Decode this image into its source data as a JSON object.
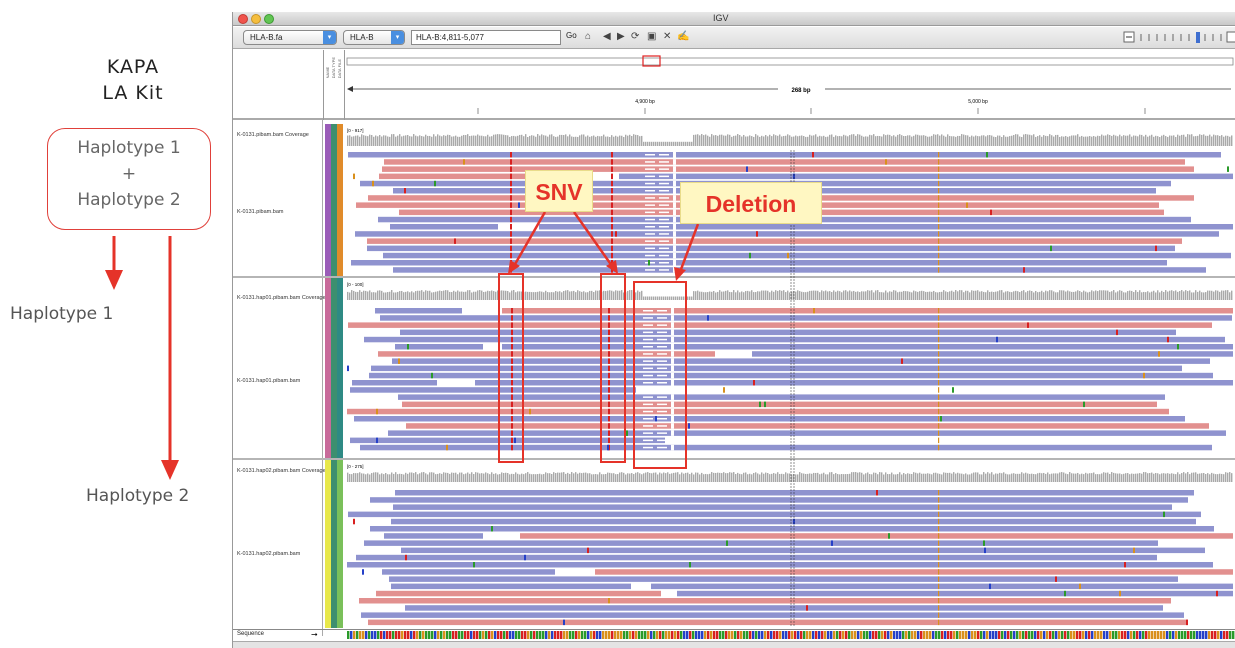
{
  "annotations": {
    "kit_line1": "KAPA",
    "kit_line2": "LA Kit",
    "combined_line1": "Haplotype 1",
    "combined_plus": "+",
    "combined_line2": "Haplotype 2",
    "haplotype1_label": "Haplotype 1",
    "haplotype2_label": "Haplotype 2",
    "snv_callout": "SNV",
    "deletion_callout": "Deletion",
    "accent_color": "#e53329",
    "callout_bg": "#fff7c2"
  },
  "window": {
    "title": "IGV"
  },
  "toolbar": {
    "genome": "HLA-B.fa",
    "chromosome": "HLA-B",
    "locus": "HLA-B:4,811-5,077",
    "go_label": "Go",
    "icons": [
      "home-icon",
      "back-icon",
      "forward-icon",
      "refresh-icon",
      "roi-icon",
      "close-icon",
      "popup-text-icon"
    ]
  },
  "ruler": {
    "span_label": "268 bp",
    "tick1": "4,900 bp",
    "tick2": "5,000 bp"
  },
  "attributes": {
    "headers": [
      "NAME",
      "DATA TYPE",
      "DATA FILE"
    ]
  },
  "tracks": {
    "panel1": {
      "coverage_name": "K-0131.pibam.bam Coverage",
      "coverage_range": "[0 - 917]",
      "alignment_name": "K-0131.pibam.bam"
    },
    "panel2": {
      "coverage_name": "K-0131.hap01.pibam.bam Coverage",
      "coverage_range": "[0 - 100]",
      "alignment_name": "K-0131.hap01.pibam.bam"
    },
    "panel3": {
      "coverage_name": "K-0131.hap02.pibam.bam Coverage",
      "coverage_range": "[0 - 275]",
      "alignment_name": "K-0131.hap02.pibam.bam"
    },
    "sequence_label": "Sequence"
  },
  "colors": {
    "read_forward": "#8f93cf",
    "read_reverse": "#e2908f",
    "coverage_bar": "#a9a9a9",
    "mismatch_a": "#2a9a2a",
    "mismatch_c": "#2540c8",
    "mismatch_g": "#d9901c",
    "mismatch_t": "#d82020"
  }
}
